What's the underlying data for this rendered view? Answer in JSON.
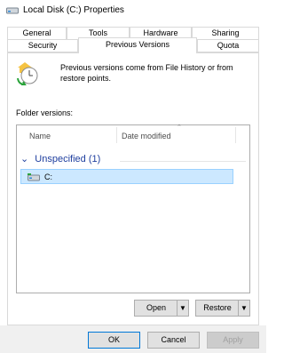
{
  "window": {
    "title": "Local Disk (C:) Properties",
    "icon": "drive-icon"
  },
  "tabs": {
    "row1": [
      "General",
      "Tools",
      "Hardware",
      "Sharing"
    ],
    "row2": [
      "Security",
      "Previous Versions",
      "Quota"
    ],
    "active": "Previous Versions"
  },
  "panel": {
    "icon": "restore-clock-icon",
    "description": "Previous versions come from File History or from restore points.",
    "folder_versions_label": "Folder versions:",
    "columns": [
      "Name",
      "Date modified"
    ],
    "group_label": "Unspecified (1)",
    "items": [
      {
        "name": "C:",
        "date": ""
      }
    ]
  },
  "actions": {
    "open_label": "Open",
    "restore_label": "Restore"
  },
  "footer": {
    "ok_label": "OK",
    "cancel_label": "Cancel",
    "apply_label": "Apply"
  },
  "colors": {
    "accent": "#0078d7",
    "selection": "#cce8ff",
    "group_text": "#1e3e9e"
  }
}
